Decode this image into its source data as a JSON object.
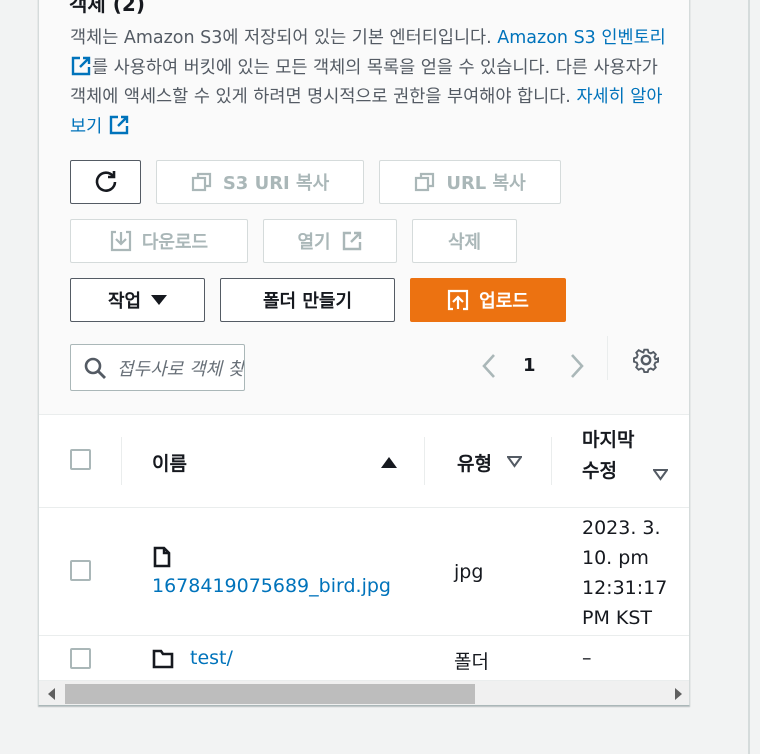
{
  "section": {
    "title": "객체 (2)",
    "description_part1": "객체는 Amazon S3에 저장되어 있는 기본 엔터티입니다. ",
    "inventory_link": "Amazon S3 인벤토리",
    "description_part2": "를 사용하여 버킷에 있는 모든 객체의 목록을 얻을 수 있습니다. 다른 사용자가 객체에 액세스할 수 있게 하려면 명시적으로 권한을 부여해야 합니다. ",
    "learn_more_link": "자세히 알아보기"
  },
  "toolbar": {
    "refresh_icon": "refresh-icon",
    "copy_s3_uri": "S3 URI 복사",
    "copy_url": "URL 복사",
    "download": "다운로드",
    "open": "열기",
    "delete": "삭제",
    "actions": "작업",
    "create_folder": "폴더 만들기",
    "upload": "업로드"
  },
  "search": {
    "placeholder": "접두사로 객체 찾기"
  },
  "pagination": {
    "current_page": "1"
  },
  "table": {
    "headers": {
      "name": "이름",
      "type": "유형",
      "last_modified": "마지막 수정"
    },
    "rows": [
      {
        "name": "1678419075689_bird.jpg",
        "type": "jpg",
        "last_modified": "2023. 3. 10. pm 12:31:17 PM KST",
        "icon": "file-icon"
      },
      {
        "name": "test/",
        "type": "폴더",
        "last_modified": "–",
        "icon": "folder-icon"
      }
    ]
  },
  "colors": {
    "link": "#0073bb",
    "primary": "#ec7211",
    "disabled": "#aab7b8"
  }
}
